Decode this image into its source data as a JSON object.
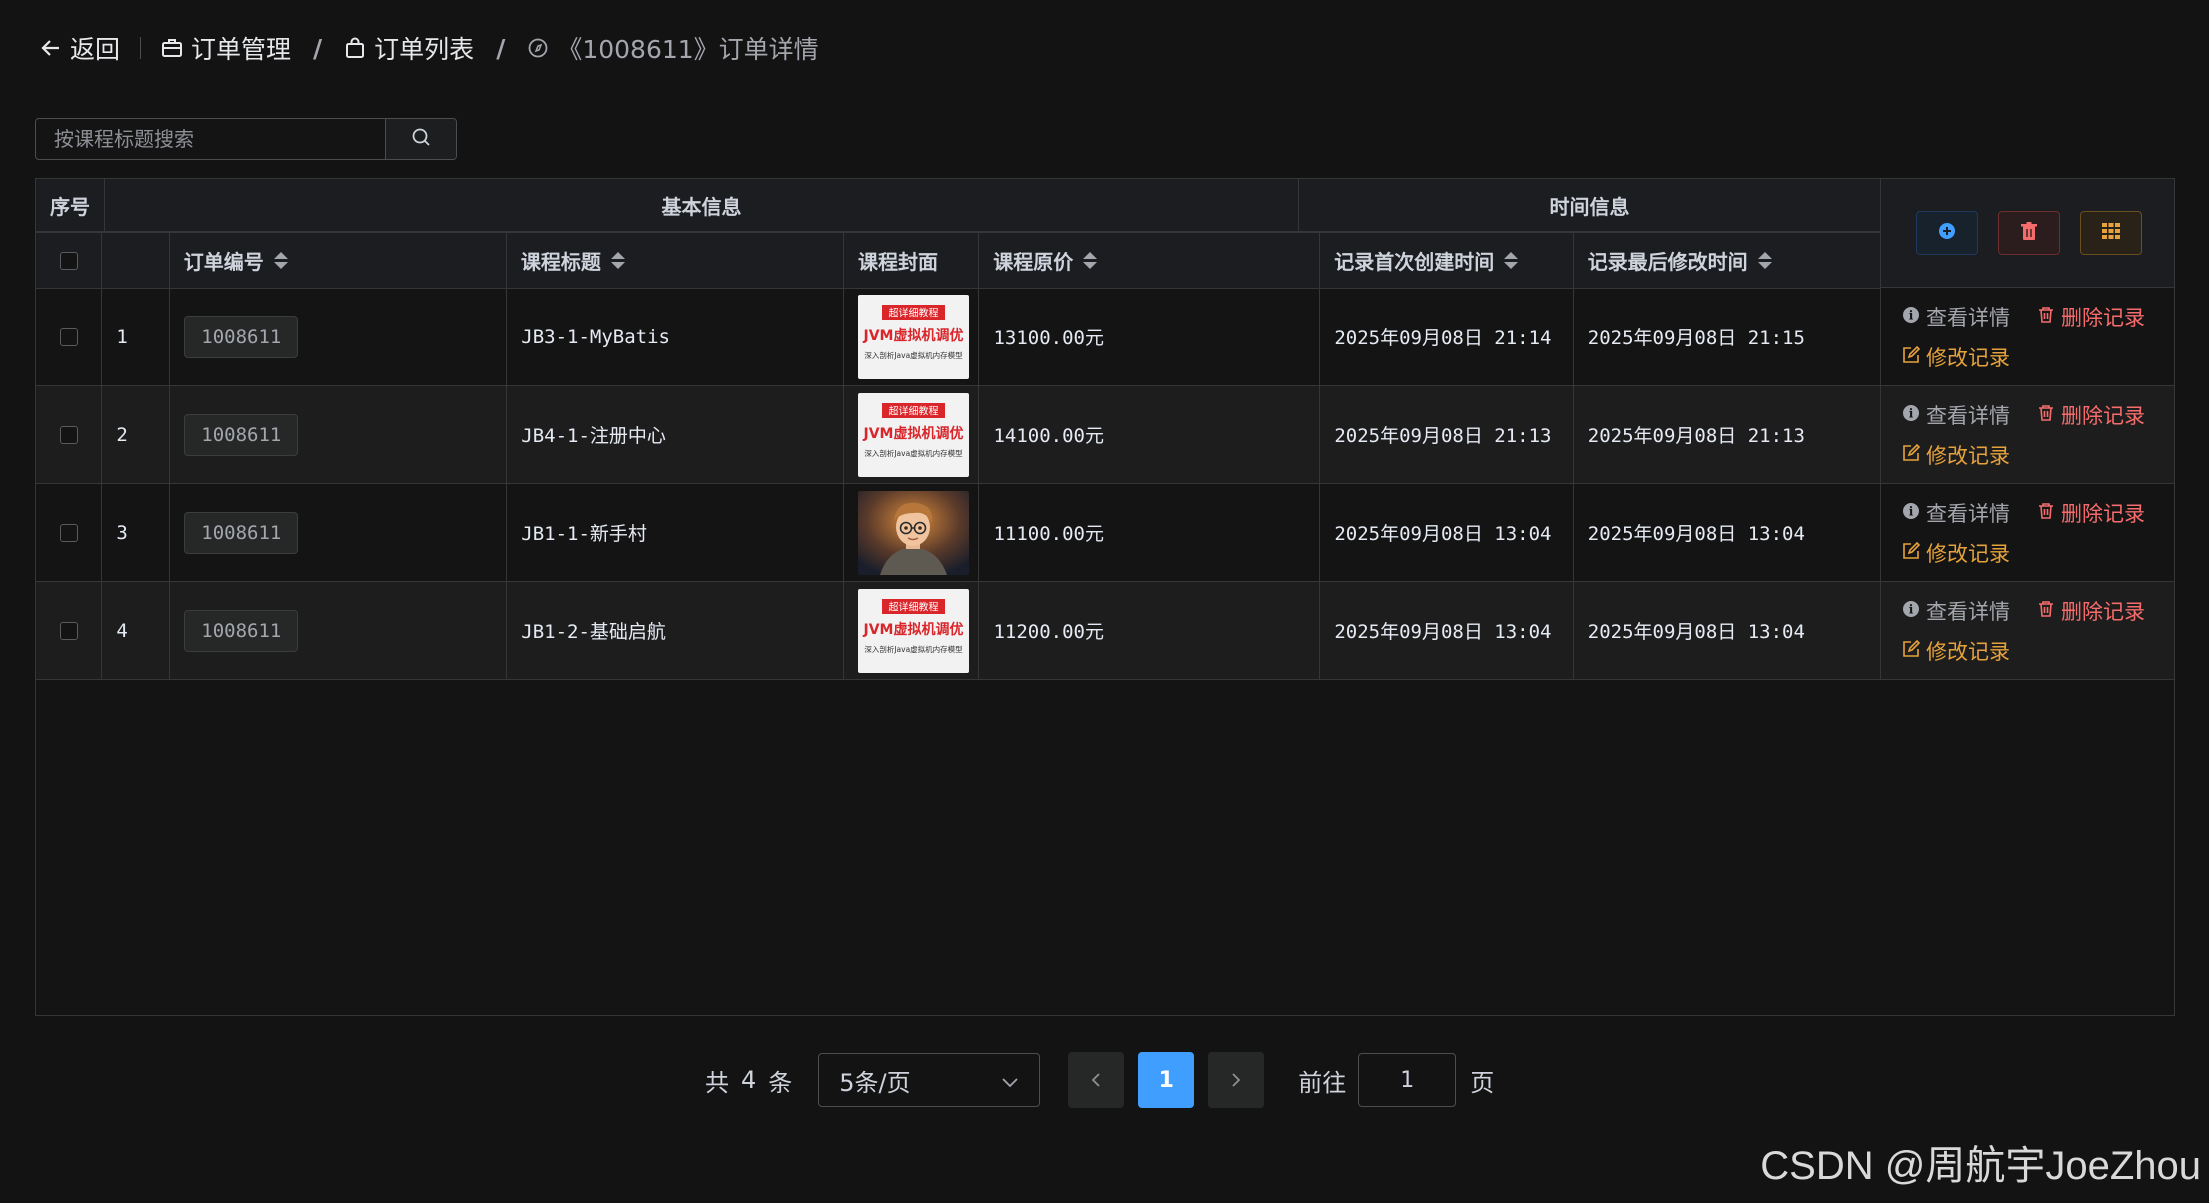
{
  "header": {
    "back_label": "返回",
    "crumbs": [
      "订单管理",
      "订单列表",
      "《1008611》订单详情"
    ]
  },
  "search": {
    "placeholder": "按课程标题搜索"
  },
  "table": {
    "groups": {
      "index": "序号",
      "basic": "基本信息",
      "time": "时间信息"
    },
    "columns": {
      "order_no": "订单编号",
      "title": "课程标题",
      "cover": "课程封面",
      "price": "课程原价",
      "created": "记录首次创建时间",
      "modified": "记录最后修改时间"
    },
    "cover_text": {
      "badge": "超详细教程",
      "main": "JVM虚拟机调优",
      "sub": "深入剖析Java虚拟机内存模型"
    },
    "rows": [
      {
        "index": "1",
        "order_no": "1008611",
        "title": "JB3-1-MyBatis",
        "price": "13100.00元",
        "created": "2025年09月08日 21:14",
        "modified": "2025年09月08日 21:15",
        "cover": "jvm"
      },
      {
        "index": "2",
        "order_no": "1008611",
        "title": "JB4-1-注册中心",
        "price": "14100.00元",
        "created": "2025年09月08日 21:13",
        "modified": "2025年09月08日 21:13",
        "cover": "jvm"
      },
      {
        "index": "3",
        "order_no": "1008611",
        "title": "JB1-1-新手村",
        "price": "11100.00元",
        "created": "2025年09月08日 13:04",
        "modified": "2025年09月08日 13:04",
        "cover": "avatar"
      },
      {
        "index": "4",
        "order_no": "1008611",
        "title": "JB1-2-基础启航",
        "price": "11200.00元",
        "created": "2025年09月08日 13:04",
        "modified": "2025年09月08日 13:04",
        "cover": "jvm"
      }
    ],
    "actions": {
      "view": "查看详情",
      "delete": "删除记录",
      "edit": "修改记录"
    }
  },
  "pagination": {
    "total_prefix": "共",
    "total": "4",
    "total_suffix": "条",
    "page_size": "5条/页",
    "current_page": "1",
    "goto_label": "前往",
    "goto_value": "1",
    "page_label": "页"
  },
  "watermark": "CSDN @周航宇JoeZhou",
  "colors": {
    "primary": "#409eff",
    "danger": "#f56c6c",
    "warning": "#e6a23c",
    "background": "#131313"
  }
}
